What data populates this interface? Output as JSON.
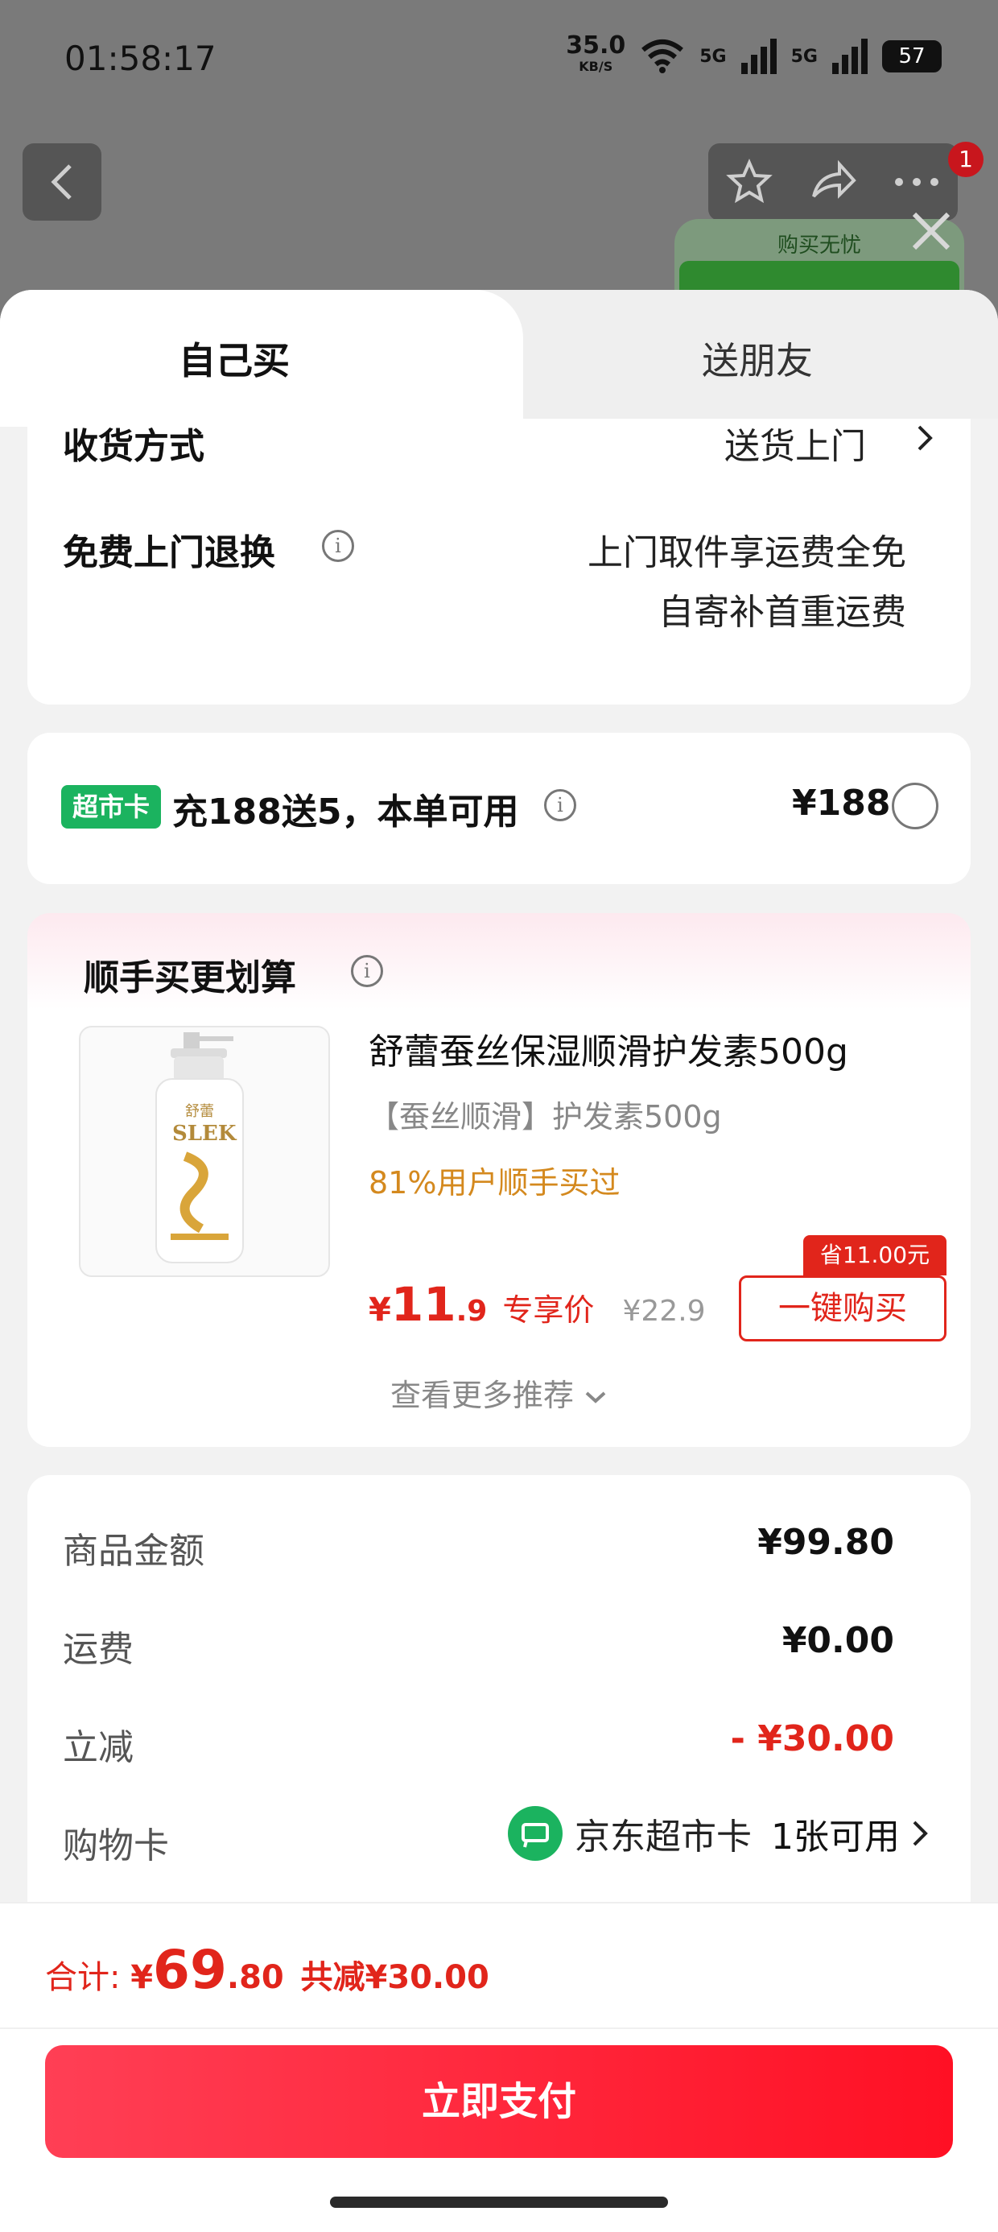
{
  "status_bar": {
    "time": "01:58:17",
    "speed_value": "35.0",
    "speed_unit": "KB/S",
    "network1": "5G",
    "network2": "5G",
    "battery": "57"
  },
  "promo_banner": {
    "text": "购买无忧"
  },
  "notification_badge": "1",
  "tabs": [
    {
      "label": "自己买"
    },
    {
      "label": "送朋友"
    }
  ],
  "delivery": {
    "method_label": "收货方式",
    "method_value": "送货上门",
    "return_label": "免费上门退换",
    "return_line1": "上门取件享运费全免",
    "return_line2": "自寄补首重运费"
  },
  "supermarket_card": {
    "chip": "超市卡",
    "text": "充188送5，本单可用",
    "price": "¥188"
  },
  "addon": {
    "title": "顺手买更划算",
    "product_name": "舒蕾蚕丝保湿顺滑护发素500g",
    "product_spec": "【蚕丝顺滑】护发素500g",
    "social_proof": "81%用户顺手买过",
    "price_symbol": "¥",
    "price_int": "11",
    "price_dec": ".9",
    "price_tag": "专享价",
    "original_price": "¥22.9",
    "save_tag": "省11.00元",
    "buy_button": "一键购买",
    "more": "查看更多推荐"
  },
  "summary": {
    "goods_label": "商品金额",
    "goods_value": "¥99.80",
    "shipping_label": "运费",
    "shipping_value": "¥0.00",
    "discount_label": "立减",
    "discount_value": "- ¥30.00",
    "card_label": "购物卡",
    "card_name": "京东超市卡",
    "card_avail": "1张可用"
  },
  "footer": {
    "total_label": "合计:",
    "total_symbol": "¥",
    "total_int": "69",
    "total_dec": ".80",
    "total_saved": "共减¥30.00",
    "pay_button": "立即支付"
  },
  "colors": {
    "accent_red": "#e1251b",
    "green": "#1bb35f"
  }
}
